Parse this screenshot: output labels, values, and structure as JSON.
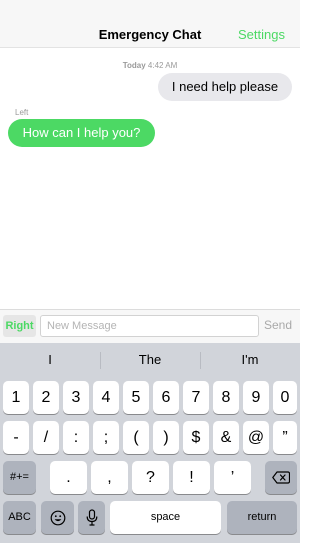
{
  "header": {
    "title": "Emergency Chat",
    "settings_label": "Settings"
  },
  "conversation": {
    "timestamp_day": "Today",
    "timestamp_time": "4:42 AM",
    "messages": [
      {
        "side": "right",
        "text": "I need help please"
      },
      {
        "side": "left",
        "sender": "Left",
        "text": "How can I help you?"
      }
    ]
  },
  "composer": {
    "side_toggle_label": "Right",
    "placeholder": "New Message",
    "value": "",
    "send_label": "Send"
  },
  "keyboard": {
    "suggestions": [
      "I",
      "The",
      "I'm"
    ],
    "row1": [
      "1",
      "2",
      "3",
      "4",
      "5",
      "6",
      "7",
      "8",
      "9",
      "0"
    ],
    "row2": [
      "-",
      "/",
      ":",
      ";",
      "(",
      ")",
      "$",
      "&",
      "@",
      "”"
    ],
    "row3": [
      ".",
      ",",
      "?",
      "!",
      "’"
    ],
    "symbols_toggle_label": "#+=",
    "abc_label": "ABC",
    "space_label": "space",
    "return_label": "return"
  },
  "colors": {
    "accent": "#4cd964",
    "incoming_bubble": "#e8e8ec",
    "keyboard_bg": "#d1d4da"
  }
}
